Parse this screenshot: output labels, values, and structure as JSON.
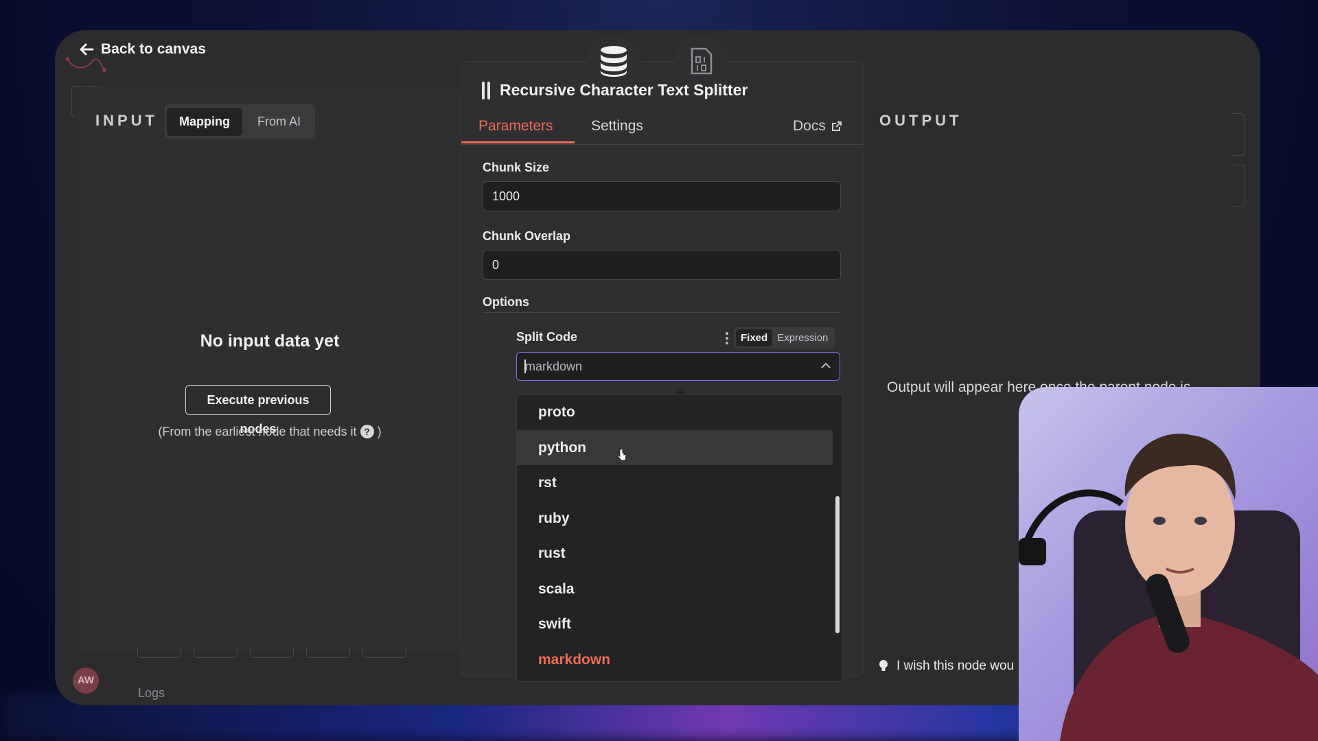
{
  "header": {
    "back_label": "Back to canvas"
  },
  "input_panel": {
    "label": "INPUT",
    "mode_tabs": [
      {
        "label": "Mapping",
        "active": true
      },
      {
        "label": "From AI",
        "active": false
      }
    ],
    "empty_title": "No input data yet",
    "execute_button": "Execute previous nodes",
    "hint_prefix": "(From the earliest node that needs it",
    "hint_help": "?",
    "hint_suffix": ")"
  },
  "node": {
    "title": "Recursive Character Text Splitter",
    "tabs": [
      {
        "label": "Parameters",
        "active": true
      },
      {
        "label": "Settings",
        "active": false
      }
    ],
    "docs_label": "Docs",
    "fields": {
      "chunk_size": {
        "label": "Chunk Size",
        "value": "1000"
      },
      "chunk_overlap": {
        "label": "Chunk Overlap",
        "value": "0"
      }
    },
    "options_label": "Options",
    "split_code": {
      "label": "Split Code",
      "mode_fixed": "Fixed",
      "mode_expression": "Expression",
      "value": "markdown",
      "options": [
        "proto",
        "python",
        "rst",
        "ruby",
        "rust",
        "scala",
        "swift",
        "markdown"
      ],
      "hovered": "python",
      "selected": "markdown"
    }
  },
  "output_panel": {
    "label": "OUTPUT",
    "message": "Output will appear here once the parent node is",
    "feedback": "I wish this node wou"
  },
  "footer": {
    "avatar_initials": "AW",
    "logs_label": "Logs"
  },
  "colors": {
    "accent": "#ef6c57",
    "focus": "#7b74d9",
    "panel": "#2f2f31",
    "window": "#2c2c2e"
  }
}
